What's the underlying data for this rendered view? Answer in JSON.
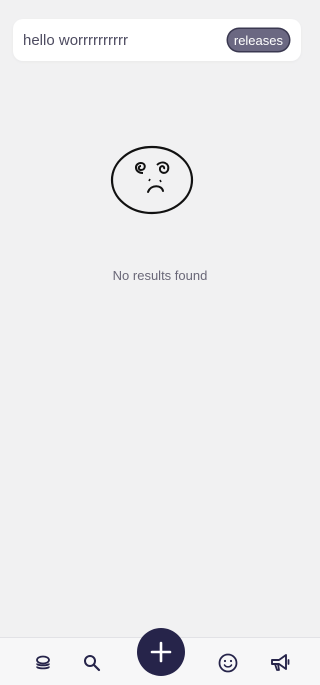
{
  "search": {
    "query": "hello worrrrrrrrrr",
    "filter_chip": "releases"
  },
  "empty_state": {
    "message": "No results found"
  },
  "tabbar": {
    "items": [
      {
        "icon": "stack-icon"
      },
      {
        "icon": "search-icon"
      },
      {
        "icon": "plus-icon"
      },
      {
        "icon": "smiley-icon"
      },
      {
        "icon": "megaphone-icon"
      }
    ]
  },
  "colors": {
    "background": "#f1f1f2",
    "accent": "#26244a",
    "chip": "#6b6882"
  }
}
